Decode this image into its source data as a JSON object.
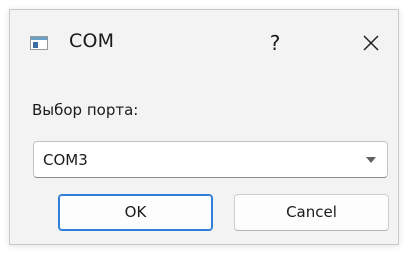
{
  "window": {
    "title": "COM",
    "help_label": "?",
    "icon": "app-window-icon",
    "close_icon": "close-icon"
  },
  "form": {
    "port_label": "Выбор порта:",
    "port_selected": "COM3"
  },
  "buttons": {
    "ok_label": "OK",
    "cancel_label": "Cancel"
  },
  "colors": {
    "accent": "#2f7fd6",
    "background": "#f3f3f3"
  }
}
